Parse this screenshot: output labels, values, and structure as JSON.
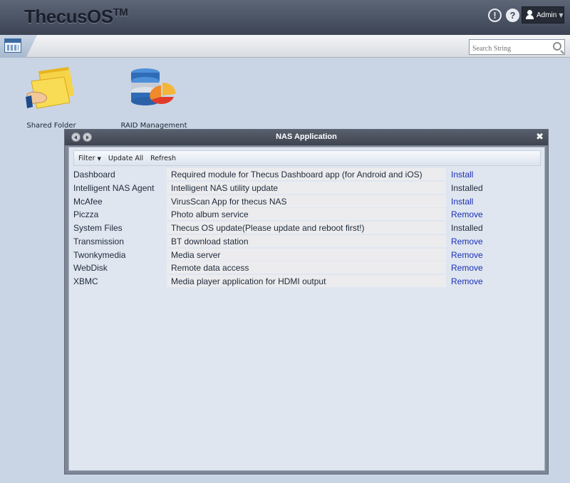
{
  "header": {
    "logo_main": "ThecusOS",
    "logo_tm": "TM",
    "notify_icon": "exclamation-circle-icon",
    "help_icon": "question-circle-icon",
    "user_label": "Admin"
  },
  "toolbar": {
    "search_placeholder": "Search String"
  },
  "desktop": {
    "items": [
      {
        "label": "Shared Folder",
        "icon": "shared-folder-icon"
      },
      {
        "label": "RAID Management",
        "icon": "raid-management-icon"
      }
    ]
  },
  "window": {
    "title": "NAS Application",
    "toolbar": {
      "filter_label": "Filter",
      "update_all_label": "Update All",
      "refresh_label": "Refresh"
    },
    "apps": [
      {
        "name": "Dashboard",
        "description": "Required module for Thecus Dashboard app (for Android and iOS)",
        "action": "Install",
        "is_link": true
      },
      {
        "name": "Intelligent NAS Agent",
        "description": "Intelligent NAS utility update",
        "action": "Installed",
        "is_link": false
      },
      {
        "name": "McAfee",
        "description": "VirusScan App for thecus NAS",
        "action": "Install",
        "is_link": true
      },
      {
        "name": "Piczza",
        "description": "Photo album service",
        "action": "Remove",
        "is_link": true
      },
      {
        "name": "System Files",
        "description": "Thecus OS update(Please update and reboot first!)",
        "action": "Installed",
        "is_link": false
      },
      {
        "name": "Transmission",
        "description": "BT download station",
        "action": "Remove",
        "is_link": true
      },
      {
        "name": "Twonkymedia",
        "description": "Media server",
        "action": "Remove",
        "is_link": true
      },
      {
        "name": "WebDisk",
        "description": "Remote data access",
        "action": "Remove",
        "is_link": true
      },
      {
        "name": "XBMC",
        "description": "Media player application for HDMI output",
        "action": "Remove",
        "is_link": true
      }
    ]
  },
  "colors": {
    "link": "#1a2fb5",
    "header_bg": "#4a5262",
    "desktop_bg": "#c9d5e4"
  }
}
